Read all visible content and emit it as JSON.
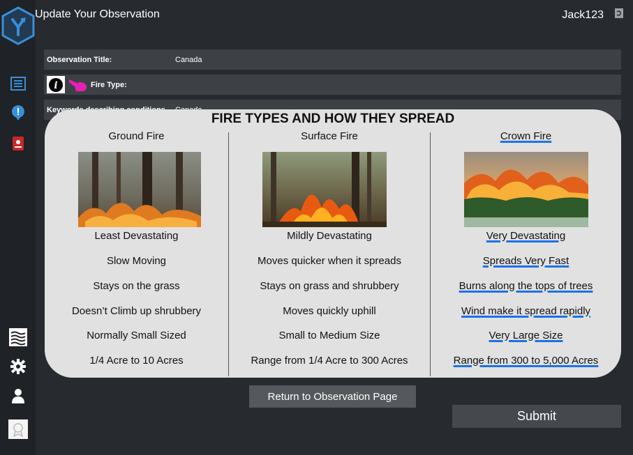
{
  "header": {
    "title": "Update Your Observation",
    "username": "Jack123"
  },
  "form": {
    "title_label": "Observation Title:",
    "title_value": "Canada",
    "fire_type_label": "Fire Type:",
    "keywords_label": "Keywords describing conditions",
    "keywords_value": "Canada"
  },
  "modal": {
    "title": "FIRE TYPES AND HOW THEY SPREAD",
    "columns": [
      {
        "name": "Ground Fire",
        "lines": [
          "Least Devastating",
          "Slow Moving",
          "Stays on the grass",
          "Doesn’t Climb up shrubbery",
          "Normally Small Sized",
          "1/4 Acre to 10 Acres"
        ]
      },
      {
        "name": "Surface Fire",
        "lines": [
          "Mildly Devastating",
          "Moves quicker when it spreads",
          "Stays on grass and shrubbery",
          "Moves quickly uphill",
          "Small to Medium Size",
          "Range from 1/4 Acre to 300 Acres"
        ]
      },
      {
        "name": "Crown Fire",
        "lines": [
          "Very Devastating",
          "Spreads Very Fast",
          "Burns along the tops of trees",
          "Wind make it spread rapidly",
          "Very Large Size",
          "Range from 300 to 5,000 Acres"
        ]
      }
    ]
  },
  "buttons": {
    "return_label": "Return to Observation Page",
    "submit_label": "Submit"
  },
  "colors": {
    "background": "#272b30",
    "sidebar": "#1f2226",
    "accent": "#3a8fd8",
    "modal": "#e1e1e1",
    "pointer": "#e91eb4"
  },
  "icons": [
    "app-logo-icon",
    "list-icon",
    "alert-icon",
    "book-icon",
    "layers-icon",
    "gear-icon",
    "user-icon",
    "badge-icon",
    "refresh-icon",
    "info-icon",
    "pointing-hand-icon"
  ]
}
